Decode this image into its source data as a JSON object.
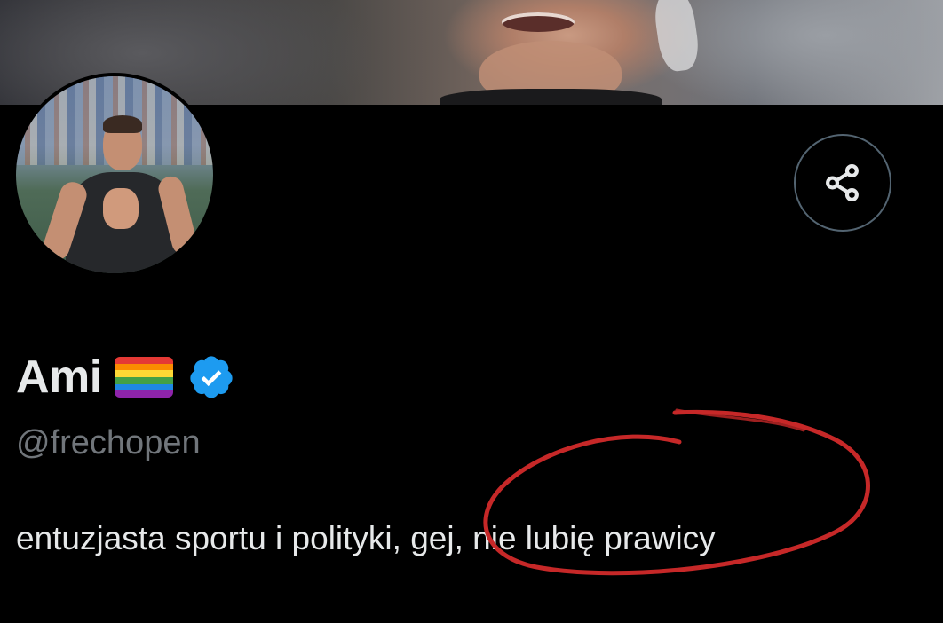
{
  "profile": {
    "display_name": "Ami",
    "handle": "@frechopen",
    "bio": "entuzjasta sportu i polityki, gej, nie lubię prawicy",
    "name_flag_icon": "rainbow-flag-icon",
    "verified_icon": "verified-badge-icon"
  },
  "colors": {
    "background": "#000000",
    "text_primary": "#e7e9ea",
    "text_secondary": "#71767b",
    "verified_blue": "#1d9bf0",
    "button_border": "#536471",
    "annotation_red": "#c62828",
    "rainbow": [
      "#e53935",
      "#fb8c00",
      "#fdd835",
      "#43a047",
      "#1e88e5",
      "#8e24aa"
    ]
  },
  "actions": {
    "share_icon": "share-icon"
  },
  "annotation": {
    "type": "hand-drawn red circle around text",
    "circled_text": "gej, nie lubię prawicy"
  }
}
